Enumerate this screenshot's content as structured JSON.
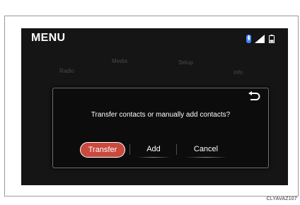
{
  "screen": {
    "title": "MENU",
    "status_icons": [
      "bluetooth-icon",
      "signal-icon",
      "battery-icon"
    ],
    "background_items": [
      "Radio",
      "Media",
      "Setup",
      "Info"
    ]
  },
  "dialog": {
    "prompt": "Transfer contacts or manually add contacts?",
    "back_icon": "back-arrow-icon",
    "buttons": {
      "transfer": "Transfer",
      "add": "Add",
      "cancel": "Cancel"
    },
    "selected_button": "transfer"
  },
  "figure": {
    "code": "CLYAVAZ107"
  },
  "colors": {
    "screen_bg": "#151515",
    "selected_button": "#c9493d",
    "text": "#ffffff"
  }
}
